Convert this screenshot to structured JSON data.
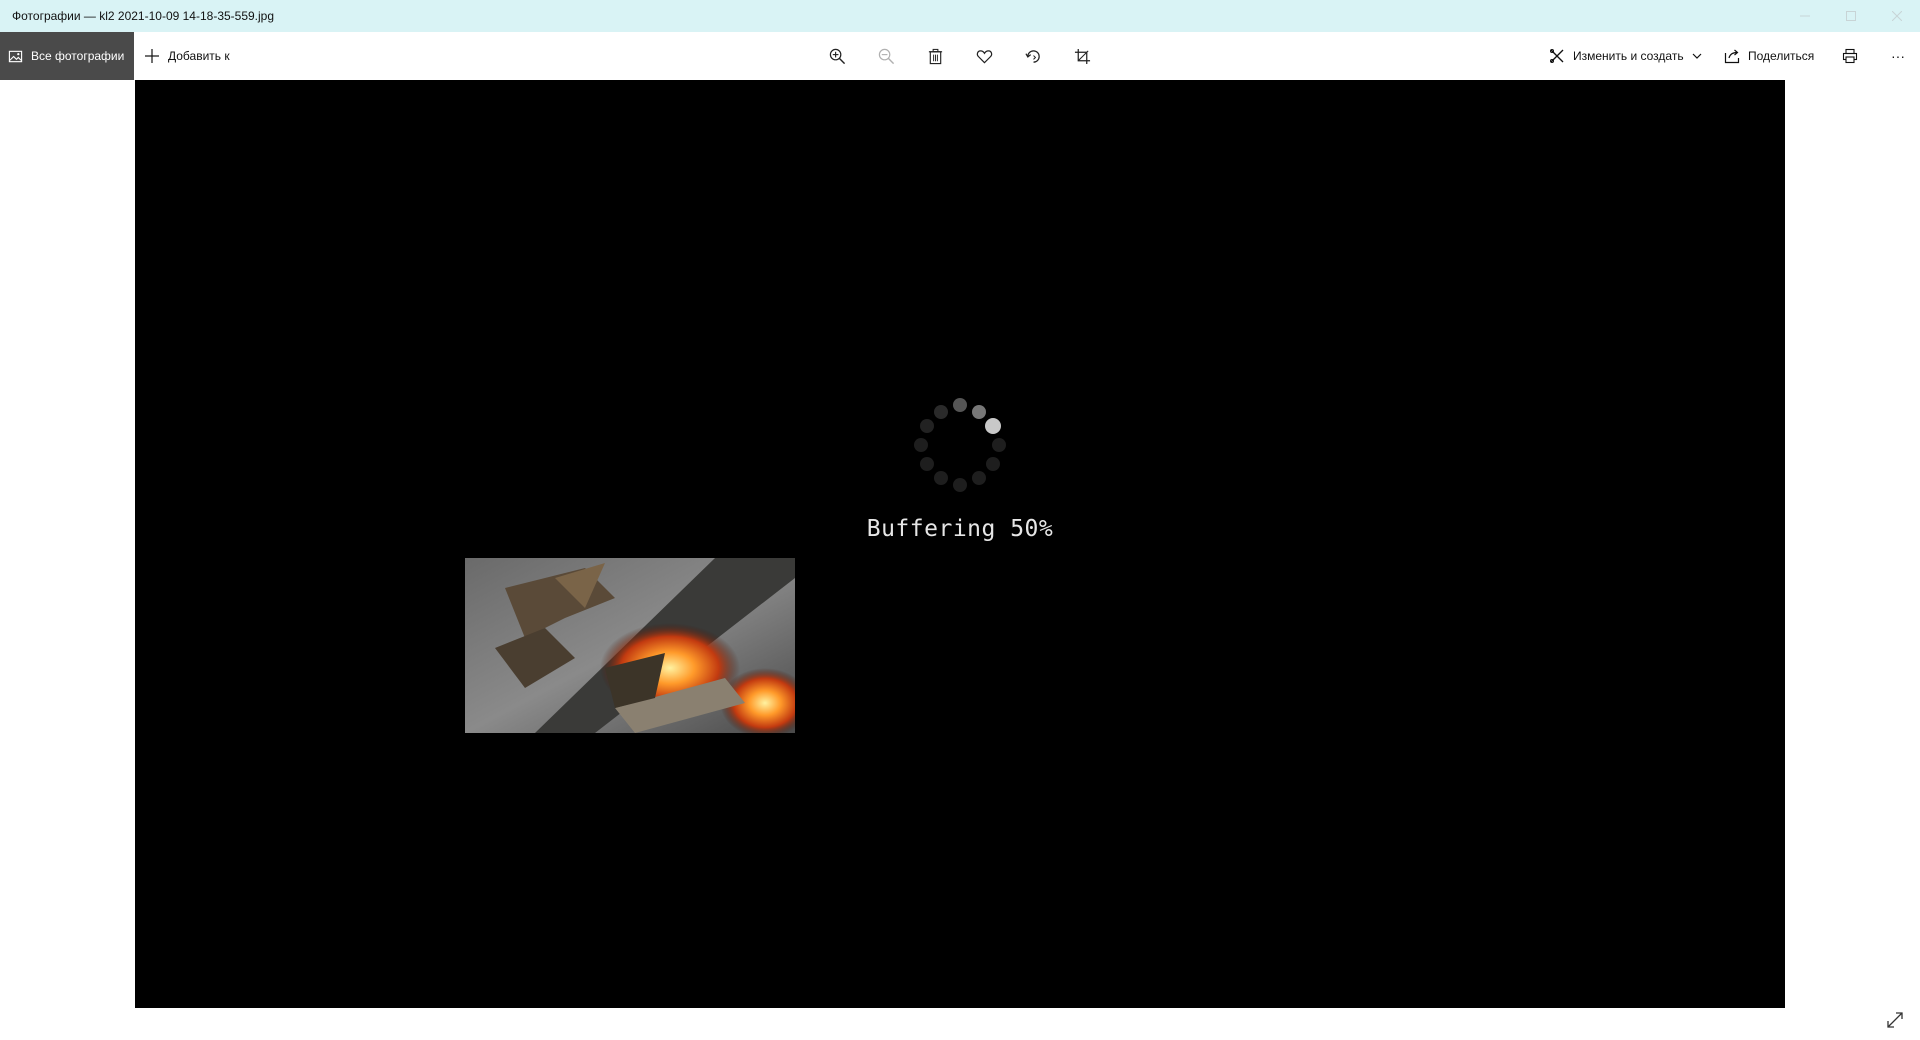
{
  "window": {
    "title": "Фотографии — kl2 2021-10-09 14-18-35-559.jpg"
  },
  "toolbar": {
    "all_photos_label": "Все фотографии",
    "add_to_label": "Добавить к",
    "edit_create_label": "Изменить и создать",
    "share_label": "Поделиться",
    "tools": [
      "zoom-in-icon",
      "zoom-out-icon",
      "delete-icon",
      "favorite-heart-icon",
      "rotate-icon",
      "crop-icon"
    ],
    "more_label": "···"
  },
  "viewer": {
    "buffering_text": "Buffering 50%",
    "buffering_progress": 0.5
  },
  "colors": {
    "titlebar_bg": "#d9f3f5",
    "active_tab_bg": "#4a4a4a",
    "viewer_bg": "#000000"
  }
}
